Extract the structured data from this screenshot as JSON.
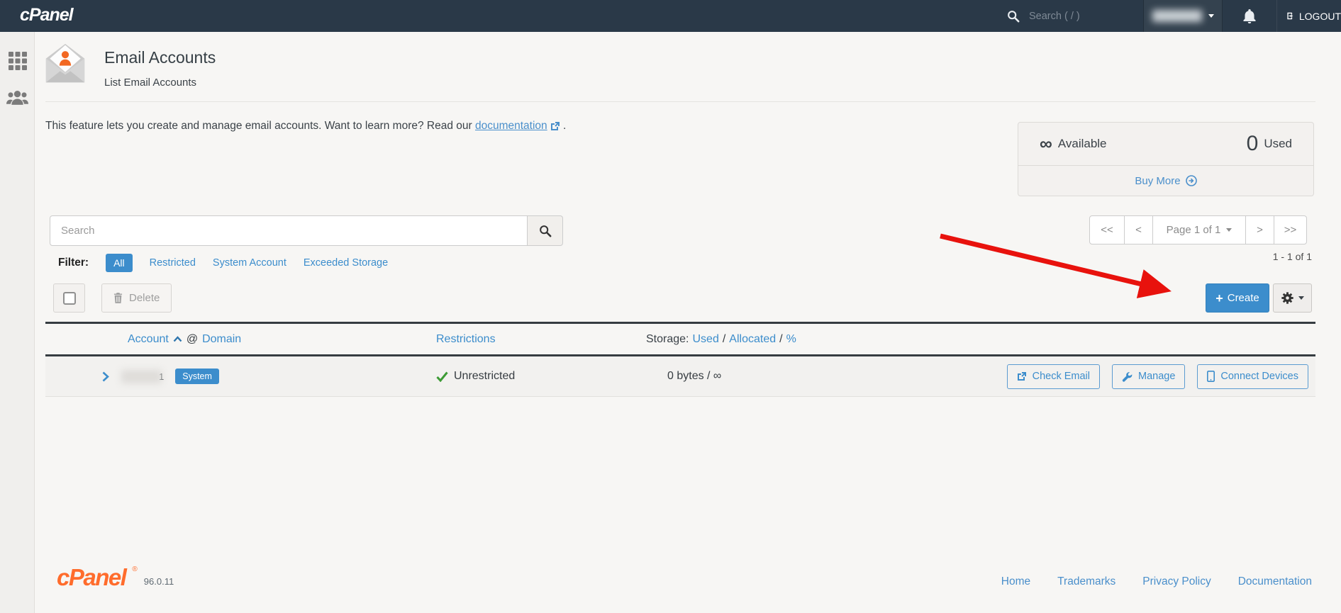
{
  "topbar": {
    "brand": "cPanel",
    "search_placeholder": "Search ( / )",
    "logout": "LOGOUT"
  },
  "page": {
    "title": "Email Accounts",
    "subtitle": "List Email Accounts"
  },
  "intro": {
    "before": "This feature lets you create and manage email accounts. Want to learn more? Read our",
    "link": "documentation",
    "after": "."
  },
  "quota": {
    "available_symbol": "∞",
    "available_label": "Available",
    "used_value": "0",
    "used_label": "Used",
    "buy_more": "Buy More"
  },
  "search": {
    "placeholder": "Search"
  },
  "pager": {
    "first": "<<",
    "prev": "<",
    "page": "Page 1 of 1",
    "next": ">",
    "last": ">>",
    "range": "1 - 1 of 1"
  },
  "filter": {
    "label": "Filter:",
    "all": "All",
    "restricted": "Restricted",
    "system_account": "System Account",
    "exceeded_storage": "Exceeded Storage"
  },
  "toolbar": {
    "delete": "Delete",
    "create_plus": "+",
    "create": "Create"
  },
  "table": {
    "account": "Account",
    "at": "@",
    "domain": "Domain",
    "restrictions": "Restrictions",
    "storage": "Storage:",
    "used": "Used",
    "allocated": "Allocated",
    "percent": "%",
    "sep": "/",
    "row": {
      "name_suffix": "1",
      "badge": "System",
      "restrictions": "Unrestricted",
      "storage": "0 bytes / ∞",
      "check_email": "Check Email",
      "manage": "Manage",
      "connect_devices": "Connect Devices"
    }
  },
  "footer": {
    "brand": "cPanel",
    "reg": "®",
    "version": "96.0.11",
    "links": [
      "Home",
      "Trademarks",
      "Privacy Policy",
      "Documentation"
    ]
  },
  "colors": {
    "topbar_bg": "#2a3948",
    "accent_blue": "#3c8dcc",
    "link_blue": "#4a8fcb",
    "success_green": "#3d9b35",
    "brand_orange": "#ff6c2c",
    "arrow_red": "#e8120d"
  }
}
